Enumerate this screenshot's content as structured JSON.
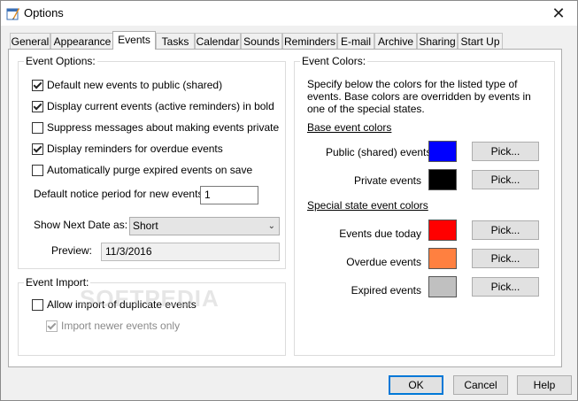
{
  "window": {
    "title": "Options",
    "close_glyph": "✕"
  },
  "tabs": [
    "General",
    "Appearance",
    "Events",
    "Tasks",
    "Calendar",
    "Sounds",
    "Reminders",
    "E-mail",
    "Archive",
    "Sharing",
    "Start Up"
  ],
  "active_tab": "Events",
  "event_options": {
    "legend": "Event Options:",
    "checkboxes": [
      {
        "label": "Default new events to public (shared)",
        "checked": true
      },
      {
        "label": "Display current events (active reminders) in bold",
        "checked": true
      },
      {
        "label": "Suppress messages about making events private",
        "checked": false
      },
      {
        "label": "Display reminders for overdue events",
        "checked": true
      },
      {
        "label": "Automatically purge expired events on save",
        "checked": false
      }
    ],
    "notice_label": "Default notice period for new events:",
    "notice_value": "1",
    "next_date_label": "Show Next Date as:",
    "next_date_value": "Short",
    "preview_label": "Preview:",
    "preview_value": "11/3/2016"
  },
  "event_import": {
    "legend": "Event Import:",
    "checkboxes": [
      {
        "label": "Allow import of duplicate events",
        "checked": false,
        "disabled": false
      },
      {
        "label": "Import newer events only",
        "checked": true,
        "disabled": true
      }
    ]
  },
  "event_colors": {
    "legend": "Event Colors:",
    "description": "Specify below the colors for the listed type of events. Base colors are overridden by events in one of the special states.",
    "base_heading": "Base event colors",
    "special_heading": "Special state event colors",
    "pick_label": "Pick...",
    "base": [
      {
        "label": "Public (shared) events",
        "color": "#0000ff"
      },
      {
        "label": "Private events",
        "color": "#000000"
      }
    ],
    "special": [
      {
        "label": "Events due today",
        "color": "#ff0000"
      },
      {
        "label": "Overdue events",
        "color": "#ff8040"
      },
      {
        "label": "Expired events",
        "color": "#c0c0c0"
      }
    ]
  },
  "buttons": {
    "ok": "OK",
    "cancel": "Cancel",
    "help": "Help"
  },
  "watermark": "SOFTPEDIA"
}
